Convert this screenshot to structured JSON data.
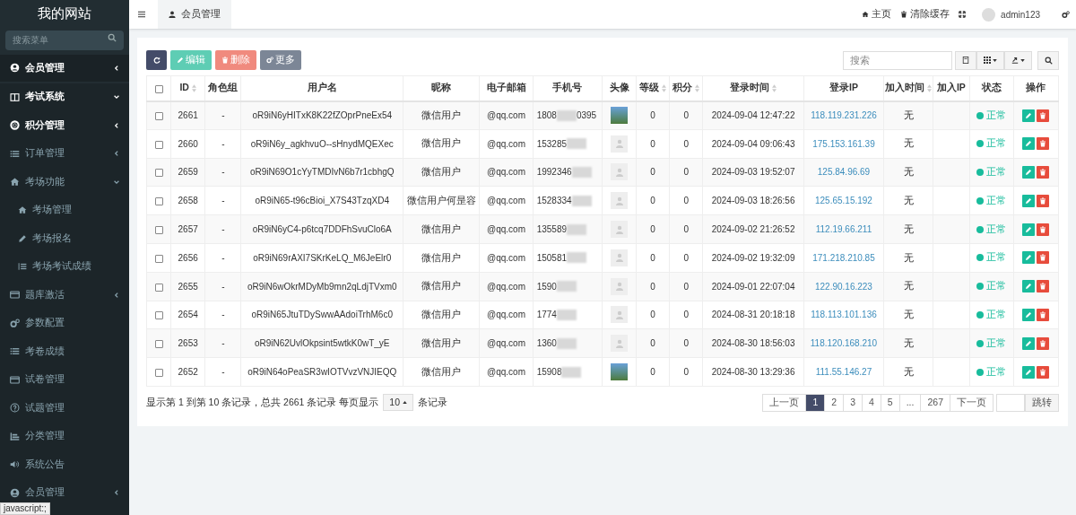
{
  "sidebar": {
    "logo": "我的网站",
    "search": {
      "placeholder": "搜索菜单"
    },
    "items": [
      {
        "label": "会员管理",
        "selected": true,
        "bold": true,
        "expanded": false
      },
      {
        "label": "考试系统",
        "selected": false,
        "bold": true,
        "expanded": true
      },
      {
        "label": "积分管理",
        "selected": false,
        "bold": true,
        "expanded": false
      },
      {
        "label": "订单管理",
        "selected": false,
        "bold": false,
        "expanded": false
      },
      {
        "label": "考场功能",
        "selected": false,
        "bold": false,
        "expanded": true,
        "children": [
          {
            "label": "考场管理",
            "selected": false
          },
          {
            "label": "考场报名",
            "selected": false
          },
          {
            "label": "考场考试成绩",
            "selected": false
          }
        ]
      },
      {
        "label": "题库激活",
        "selected": false,
        "bold": false,
        "expanded": false
      },
      {
        "label": "参数配置",
        "selected": false,
        "bold": false
      },
      {
        "label": "考卷成绩",
        "selected": false,
        "bold": false
      },
      {
        "label": "试卷管理",
        "selected": false,
        "bold": false
      },
      {
        "label": "试题管理",
        "selected": false,
        "bold": false
      },
      {
        "label": "分类管理",
        "selected": false,
        "bold": false
      },
      {
        "label": "系统公告",
        "selected": false,
        "bold": false
      },
      {
        "label": "会员管理",
        "selected": false,
        "bold": false,
        "expanded": false
      }
    ]
  },
  "header": {
    "tabs": [
      {
        "label": "会员管理",
        "selected": true
      }
    ],
    "links": [
      {
        "label": "主页"
      },
      {
        "label": "清除缓存"
      }
    ],
    "user": "admin123"
  },
  "toolbar": {
    "buttons": [
      {
        "kind": "refresh"
      },
      {
        "kind": "edit",
        "label": "编辑"
      },
      {
        "kind": "delete",
        "label": "删除"
      },
      {
        "kind": "more",
        "label": "更多"
      }
    ],
    "search": {
      "placeholder": "搜索"
    }
  },
  "table": {
    "select_all_checked": false,
    "columns": [
      {
        "label": "ID",
        "sortable": true
      },
      {
        "label": "角色组",
        "sortable": false
      },
      {
        "label": "用户名",
        "sortable": false
      },
      {
        "label": "昵称",
        "sortable": false
      },
      {
        "label": "电子邮箱",
        "sortable": false
      },
      {
        "label": "手机号",
        "sortable": false
      },
      {
        "label": "头像",
        "sortable": false
      },
      {
        "label": "等级",
        "sortable": true
      },
      {
        "label": "积分",
        "sortable": true
      },
      {
        "label": "登录时间",
        "sortable": true
      },
      {
        "label": "登录IP",
        "sortable": false
      },
      {
        "label": "加入时间",
        "sortable": true
      },
      {
        "label": "加入IP",
        "sortable": false
      },
      {
        "label": "状态",
        "sortable": false
      },
      {
        "label": "操作",
        "sortable": false
      }
    ],
    "rows": [
      {
        "checked": false,
        "id": "2661",
        "group": "-",
        "username": "oR9iN6yHITxK8K22fZOprPneEx54",
        "nickname": "微信用户",
        "email": "@qq.com",
        "phone": "1808",
        "phone_tail": "0395",
        "kind": "photo",
        "level": "0",
        "score": "0",
        "login_time": "2024-09-04 12:47:22",
        "login_ip": "118.119.231.226",
        "join_time": "无",
        "status": "正常",
        "color": "#18bc9c"
      },
      {
        "checked": false,
        "id": "2660",
        "group": "-",
        "username": "oR9iN6y_agkhvuO--sHnydMQEXec",
        "nickname": "微信用户",
        "email": "@qq.com",
        "phone": "153285",
        "kind": "default",
        "level": "0",
        "score": "0",
        "login_time": "2024-09-04 09:06:43",
        "login_ip": "175.153.161.39",
        "join_time": "无",
        "status": "正常",
        "color": "#18bc9c"
      },
      {
        "checked": false,
        "id": "2659",
        "group": "-",
        "username": "oR9iN69O1cYyTMDIvN6b7r1cbhgQ",
        "nickname": "微信用户",
        "email": "@qq.com",
        "phone": "1992346",
        "kind": "default",
        "level": "0",
        "score": "0",
        "login_time": "2024-09-03 19:52:07",
        "login_ip": "125.84.96.69",
        "join_time": "无",
        "status": "正常",
        "color": "#18bc9c"
      },
      {
        "checked": false,
        "id": "2658",
        "group": "-",
        "username": "oR9iN65-t96cBioi_X7S43TzqXD4",
        "nickname": "微信用户何昰容",
        "email": "@qq.com",
        "phone": "1528334",
        "kind": "default",
        "level": "0",
        "score": "0",
        "login_time": "2024-09-03 18:26:56",
        "login_ip": "125.65.15.192",
        "join_time": "无",
        "status": "正常",
        "color": "#18bc9c"
      },
      {
        "checked": false,
        "id": "2657",
        "group": "-",
        "username": "oR9iN6yC4-p6tcq7DDFhSvuClo6A",
        "nickname": "微信用户",
        "email": "@qq.com",
        "phone": "135589",
        "kind": "default",
        "level": "0",
        "score": "0",
        "login_time": "2024-09-02 21:26:52",
        "login_ip": "112.19.66.211",
        "join_time": "无",
        "status": "正常",
        "color": "#18bc9c"
      },
      {
        "checked": false,
        "id": "2656",
        "group": "-",
        "username": "oR9iN69rAXI7SKrKeLQ_M6JeElr0",
        "nickname": "微信用户",
        "email": "@qq.com",
        "phone": "150581",
        "kind": "default",
        "level": "0",
        "score": "0",
        "login_time": "2024-09-02 19:32:09",
        "login_ip": "171.218.210.85",
        "join_time": "无",
        "status": "正常",
        "color": "#18bc9c"
      },
      {
        "checked": false,
        "id": "2655",
        "group": "-",
        "username": "oR9iN6wOkrMDyMb9mn2qLdjTVxm0",
        "nickname": "微信用户",
        "email": "@qq.com",
        "phone": "1590",
        "kind": "default",
        "level": "0",
        "score": "0",
        "login_time": "2024-09-01 22:07:04",
        "login_ip": "122.90.16.223",
        "join_time": "无",
        "status": "正常",
        "color": "#18bc9c"
      },
      {
        "checked": false,
        "id": "2654",
        "group": "-",
        "username": "oR9iN65JtuTDySwwAAdoiTrhM6c0",
        "nickname": "微信用户",
        "email": "@qq.com",
        "phone": "1774",
        "kind": "default",
        "level": "0",
        "score": "0",
        "login_time": "2024-08-31 20:18:18",
        "login_ip": "118.113.101.136",
        "join_time": "无",
        "status": "正常",
        "color": "#18bc9c"
      },
      {
        "checked": false,
        "id": "2653",
        "group": "-",
        "username": "oR9iN62UvlOkpsint5wtkK0wT_yE",
        "nickname": "微信用户",
        "email": "@qq.com",
        "phone": "1360",
        "kind": "default",
        "level": "0",
        "score": "0",
        "login_time": "2024-08-30 18:56:03",
        "login_ip": "118.120.168.210",
        "join_time": "无",
        "status": "正常",
        "color": "#18bc9c"
      },
      {
        "checked": false,
        "id": "2652",
        "group": "-",
        "username": "oR9iN64oPeaSR3wIOTVvzVNJIEQQ",
        "nickname": "微信用户",
        "email": "@qq.com",
        "phone": "15908",
        "kind": "photo",
        "level": "0",
        "score": "0",
        "login_time": "2024-08-30 13:29:36",
        "login_ip": "111.55.146.27",
        "join_time": "无",
        "status": "正常",
        "color": "#18bc9c"
      }
    ]
  },
  "footer": {
    "summary": "显示第 1 到第 10 条记录，总共 2661 条记录 每页显示",
    "page_size": "10",
    "page_size_suffix": "条记录",
    "pages": [
      {
        "label": "上一页",
        "selected": false
      },
      {
        "label": "1",
        "selected": true
      },
      {
        "label": "2",
        "selected": false
      },
      {
        "label": "3",
        "selected": false
      },
      {
        "label": "4",
        "selected": false
      },
      {
        "label": "5",
        "selected": false
      },
      {
        "label": "...",
        "selected": false
      },
      {
        "label": "267",
        "selected": false
      },
      {
        "label": "下一页",
        "selected": false
      }
    ],
    "jump": "跳转"
  },
  "status_bar": "javascript:;"
}
